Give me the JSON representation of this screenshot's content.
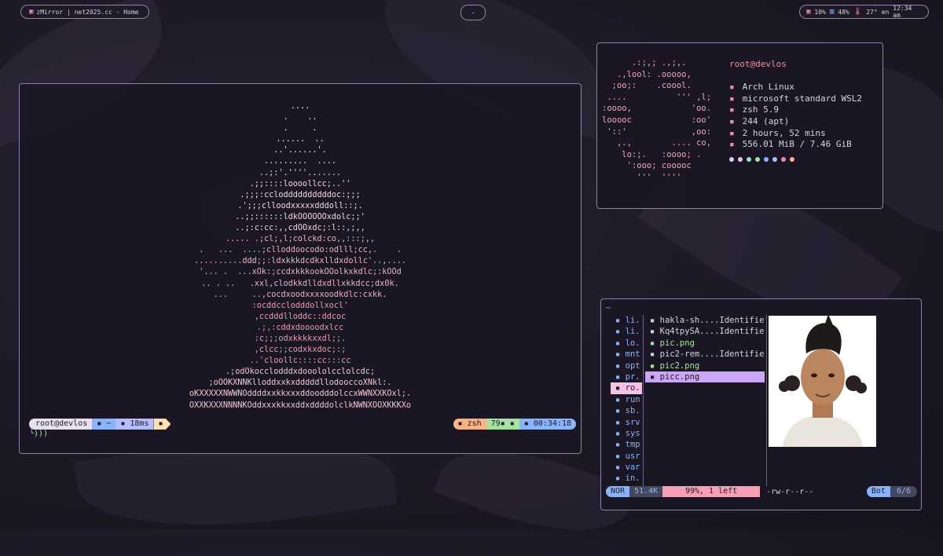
{
  "topbar": {
    "left_label": "zMirror | net2025.cc - Home",
    "mid_label": "-",
    "cpu": "10%",
    "mem": "48%",
    "temp": "27°",
    "lang": "en",
    "clock": "12:34 am"
  },
  "terminal": {
    "ascii_art": [
      "....",
      ".    ..",
      ".     .",
      "......  ..",
      "..'......'.",
      ".........  ....",
      "..;:'.''''.......",
      ".;;::::loooollcc;..''",
      ".;;;:ccloddddddddddoc:;;;",
      ".';;;clloodxxxxxdddoll::;.",
      "..;;::::::ldkOOOOOOxdolc;;'",
      "..;:c:cc:,,cdOOxdc;:l::,;,,",
      "..... .;cl;,l;colckd:co,,:::;,,",
      ".   ...  ....;clloddoocodo:odlll;cc,.    .",
      "..........ddd;;:ldxkkkdcdkxlldxdollc'..,....",
      "'... .  ...xOk:;ccdxkkkookOOolkxkdlc;:kOOd",
      ".. . ..   .xxl,clodkkdlldxdllxkkdcc;dx0k.",
      "...     ..,cocdxoodxxxxoodkdlc:cxkk.",
      ":ocddcclodddollxocl'",
      ",ccdddlloddc::ddcoc",
      ".;,:cddxdoooodxlcc",
      ":c;;;odxkkkkxxdl;;.",
      ",clcc;;codxkxdoc;:;",
      "..'cloollc::::cc:::cc",
      ".;odOkocclodddxdooololcclolcdc;",
      ";oOOKXNNKlloddxxkxdddddllodooccoXNkl:.",
      "oKXXXXXNWWNOddddxxkkxxxddoodddolccxWWNXXKOxl;.",
      "OXXKXXXNNNNKOddxxxkkxxddxddddolclkNWNXOOXKKKXo"
    ],
    "prompt_user": "root@devlos",
    "prompt_dir": "~",
    "prompt_time": "18ms",
    "prompt_line2": ")))",
    "rprompt_shell": "zsh",
    "rprompt_status": "79",
    "rprompt_clock": "00:34:18"
  },
  "fetch": {
    "logo": [
      "      .:;,; .,;,.",
      "   .,lool: .ooooo,",
      "  ;oo;:    .coool.",
      " ....          ''' ,l;",
      ":oooo,            'oo.",
      "looooc            :oo'",
      " '::'             ,oo:",
      "   ,.,        .... co,",
      "    lo:;.   :oooo; .",
      "     ':ooo; cooooc",
      "       '''  ''''"
    ],
    "host": "root@devlos",
    "os": "Arch Linux",
    "kernel": "microsoft standard WSL2",
    "shell": "zsh 5.9",
    "packages": "244 (apt)",
    "uptime": "2 hours, 52 mins",
    "memory": "556.01 MiB / 7.46 GiB",
    "palette": [
      "#cdd6f4",
      "#f5c2e7",
      "#94e2d5",
      "#a6e3a1",
      "#89b4fa",
      "#b4befe",
      "#f38ba8",
      "#fab387"
    ]
  },
  "filemanager": {
    "path": "~",
    "parent_items": [
      "li...",
      "li...",
      "lo...",
      "mnt",
      "opt",
      "pr...",
      "ro...",
      "run",
      "sb...",
      "srv",
      "sys",
      "tmp",
      "usr",
      "var",
      "in..."
    ],
    "files": [
      {
        "name": "hakla-sh....Identifier",
        "kind": "file"
      },
      {
        "name": "Kq4tpySA....Identifier",
        "kind": "file"
      },
      {
        "name": "pic.png",
        "kind": "img"
      },
      {
        "name": "pic2-rem....Identifier",
        "kind": "file"
      },
      {
        "name": "pic2.png",
        "kind": "img"
      },
      {
        "name": "picc.png",
        "kind": "img"
      }
    ],
    "status_mode": "NOR",
    "status_size": "51.4K",
    "status_progress": "99%, 1 left",
    "status_perm_chars": [
      "-",
      "rw",
      "-",
      "r",
      "--",
      "r",
      "--"
    ],
    "status_pos": "Bot",
    "status_count": "6/6"
  },
  "colors": {
    "accent_blue": "#89b4fa",
    "accent_pink": "#f5c2e7",
    "accent_mauve": "#cba6f7",
    "accent_red": "#f38ba8"
  }
}
